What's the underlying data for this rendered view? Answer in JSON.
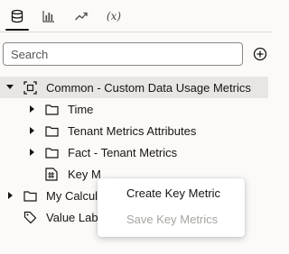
{
  "tabs": [
    {
      "name": "data-icon",
      "active": true
    },
    {
      "name": "visualizations-icon",
      "active": false
    },
    {
      "name": "analytics-icon",
      "active": false
    },
    {
      "name": "calculations-icon",
      "label": "(x)",
      "active": false
    }
  ],
  "search": {
    "placeholder": "Search",
    "value": ""
  },
  "tree": {
    "root": {
      "label": "Common - Custom Data Usage Metrics",
      "expanded": true,
      "icon": "subject-area-icon"
    },
    "children": [
      {
        "label": "Time",
        "icon": "folder-icon",
        "expandable": true
      },
      {
        "label": "Tenant Metrics Attributes",
        "icon": "folder-icon",
        "expandable": true
      },
      {
        "label": "Fact - Tenant Metrics",
        "icon": "folder-icon",
        "expandable": true
      },
      {
        "label": "Key M",
        "icon": "key-metrics-icon",
        "expandable": false
      }
    ],
    "siblings": [
      {
        "label": "My Calcula",
        "icon": "folder-icon",
        "expandable": true
      },
      {
        "label": "Value Labe",
        "icon": "tag-icon",
        "expandable": false
      }
    ]
  },
  "context_menu": {
    "items": [
      {
        "label": "Create Key Metric",
        "enabled": true
      },
      {
        "label": "Save Key Metrics",
        "enabled": false
      }
    ]
  },
  "colors": {
    "text": "#161513",
    "selected_row": "#e8e6e4",
    "disabled": "#a8a5a2",
    "background": "#fbfaf9"
  }
}
